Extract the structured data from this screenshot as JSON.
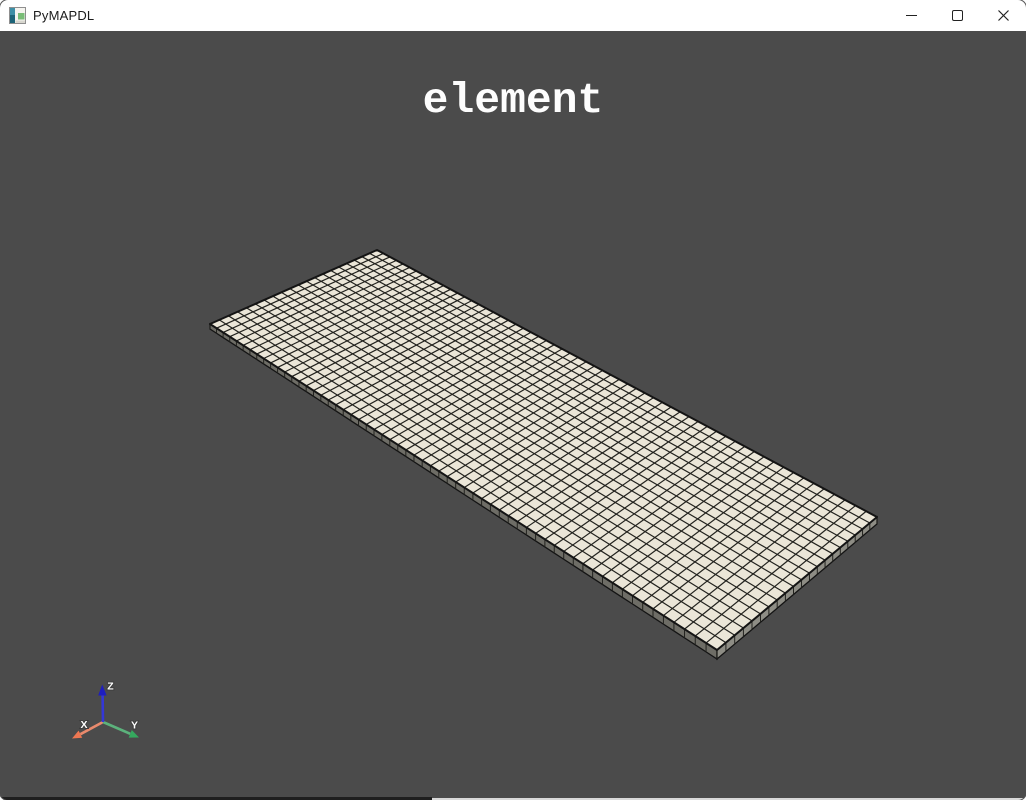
{
  "window": {
    "title": "PyMAPDL",
    "controls": {
      "minimize": "minimize",
      "maximize": "maximize",
      "close": "close"
    }
  },
  "viewport": {
    "background_color": "#4b4b4b",
    "title": "element"
  },
  "scene": {
    "mesh": {
      "type": "quad-element-plate-mesh",
      "elements_long_edge": 60,
      "elements_short_edge": 20,
      "face_color": "#ebe6d8",
      "edge_color": "#22221e",
      "outline_color": "#141414",
      "side_left_color": "#6e6d66",
      "side_right_color": "#8e8d85"
    },
    "axes_widget": {
      "x": {
        "label": "X",
        "shaft_color": "#e98a6d",
        "head_color": "#ee7752"
      },
      "y": {
        "label": "Y",
        "shaft_color": "#5cb27c",
        "head_color": "#35a95e"
      },
      "z": {
        "label": "Z",
        "shaft_color": "#3437d8",
        "head_color": "#1e1ec0"
      },
      "label_color": "#ffffff"
    }
  }
}
